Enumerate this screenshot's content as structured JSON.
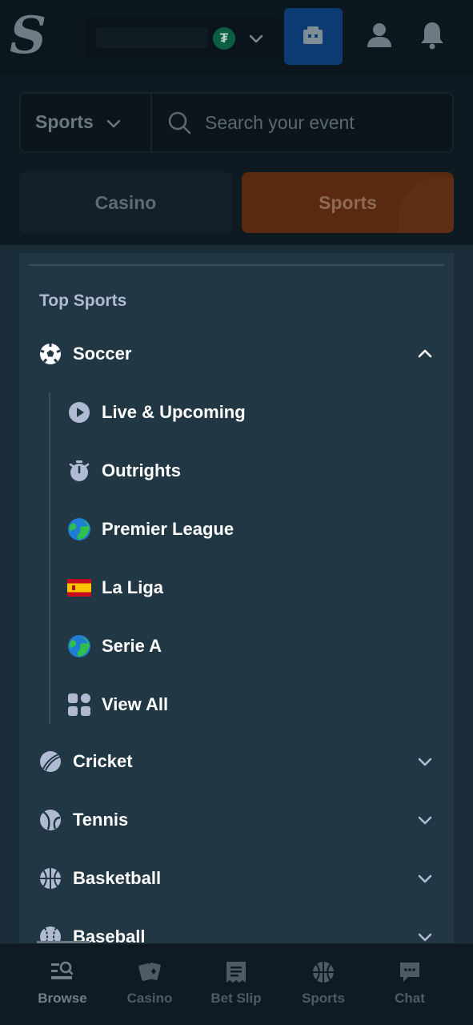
{
  "header": {
    "logo_text": "S",
    "currency_symbol": "₮",
    "icons": [
      "caret-down-icon",
      "wallet-icon",
      "user-icon",
      "bell-icon"
    ]
  },
  "search": {
    "scope_label": "Sports",
    "placeholder": "Search your event"
  },
  "mode_tabs": {
    "casino": "Casino",
    "sports": "Sports"
  },
  "menu": {
    "section_title": "Top Sports",
    "sports": [
      {
        "label": "Soccer",
        "icon": "soccer-ball-icon",
        "expanded": true
      },
      {
        "label": "Cricket",
        "icon": "cricket-ball-icon",
        "expanded": false
      },
      {
        "label": "Tennis",
        "icon": "tennis-ball-icon",
        "expanded": false
      },
      {
        "label": "Basketball",
        "icon": "basketball-icon",
        "expanded": false
      },
      {
        "label": "Baseball",
        "icon": "baseball-icon",
        "expanded": false
      }
    ],
    "soccer_items": [
      {
        "label": "Live & Upcoming",
        "icon": "play-icon"
      },
      {
        "label": "Outrights",
        "icon": "stopwatch-icon"
      },
      {
        "label": "Premier League",
        "icon": "globe-icon"
      },
      {
        "label": "La Liga",
        "icon": "spain-flag-icon"
      },
      {
        "label": "Serie A",
        "icon": "globe-icon"
      },
      {
        "label": "View All",
        "icon": "grid-icon"
      }
    ]
  },
  "bottom_nav": [
    {
      "label": "Browse",
      "icon": "browse-icon",
      "active": true
    },
    {
      "label": "Casino",
      "icon": "cards-icon",
      "active": false
    },
    {
      "label": "Bet Slip",
      "icon": "betslip-icon",
      "active": false
    },
    {
      "label": "Sports",
      "icon": "sports-ball-icon",
      "active": false
    },
    {
      "label": "Chat",
      "icon": "chat-icon",
      "active": false
    }
  ],
  "colors": {
    "panel": "#213743",
    "page": "#1a2c38",
    "accent_blue": "#1475e1",
    "accent_orange": "#ff7a1a"
  }
}
